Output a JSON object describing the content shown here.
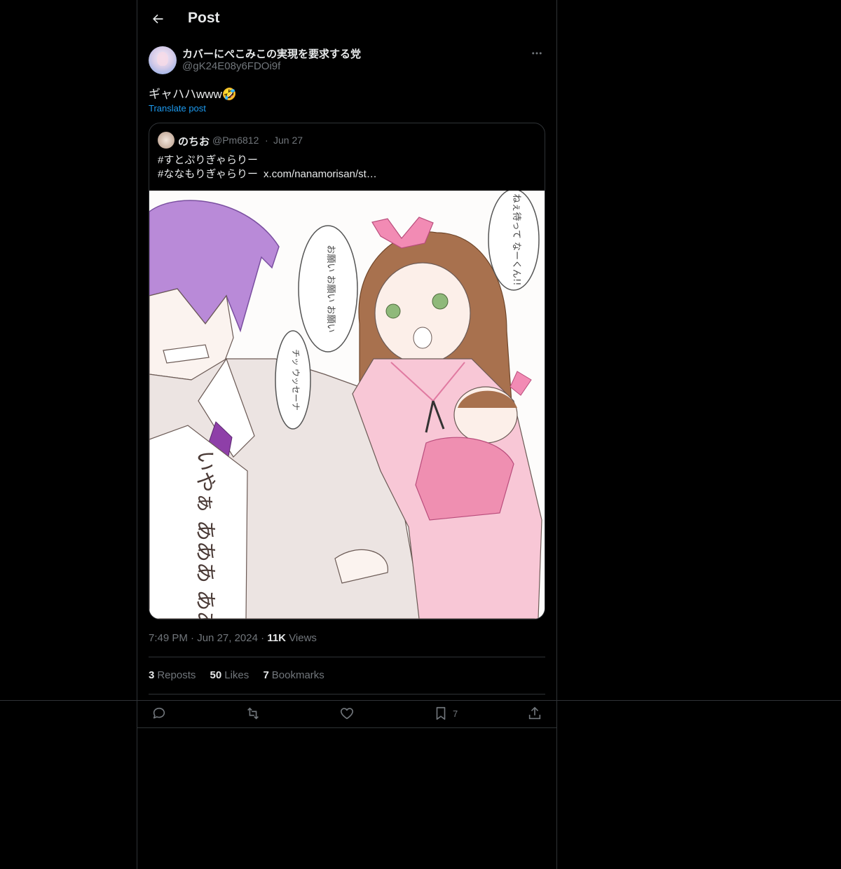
{
  "header": {
    "title": "Post"
  },
  "post": {
    "display_name": "カバーにぺこみこの実現を要求する党",
    "handle": "@gK24E08y6FDOi9f",
    "text": "ギャハハwww🤣",
    "translate_label": "Translate post",
    "time": "7:49 PM",
    "date": "Jun 27, 2024",
    "views_count": "11K",
    "views_label": "Views"
  },
  "quoted": {
    "display_name": "のちお",
    "handle": "@Pm6812",
    "separator": "·",
    "date": "Jun 27",
    "line1": "#すとぷりぎゃらりー",
    "line2_tag": "#ななもりぎゃらりー",
    "line2_link": "x.com/nanamorisan/st…"
  },
  "stats": {
    "reposts_count": "3",
    "reposts_label": "Reposts",
    "likes_count": "50",
    "likes_label": "Likes",
    "bookmarks_count": "7",
    "bookmarks_label": "Bookmarks"
  },
  "actions": {
    "bookmark_count": "7"
  },
  "illustration": {
    "speech_1": "お願い お願い お願い",
    "speech_2": "ねぇ待って なーくん!!",
    "speech_3": "チッ ウッセーナ",
    "scream": "いやぁ あああ ああ"
  },
  "colors": {
    "background": "#000000",
    "border": "#2f3336",
    "text_primary": "#e7e9ea",
    "text_secondary": "#71767b",
    "link": "#1d9bf0"
  },
  "icons": {
    "back": "arrow-left-icon",
    "more": "more-dots-icon",
    "reply": "reply-icon",
    "repost": "repost-icon",
    "like": "heart-icon",
    "bookmark": "bookmark-icon",
    "share": "share-icon"
  }
}
